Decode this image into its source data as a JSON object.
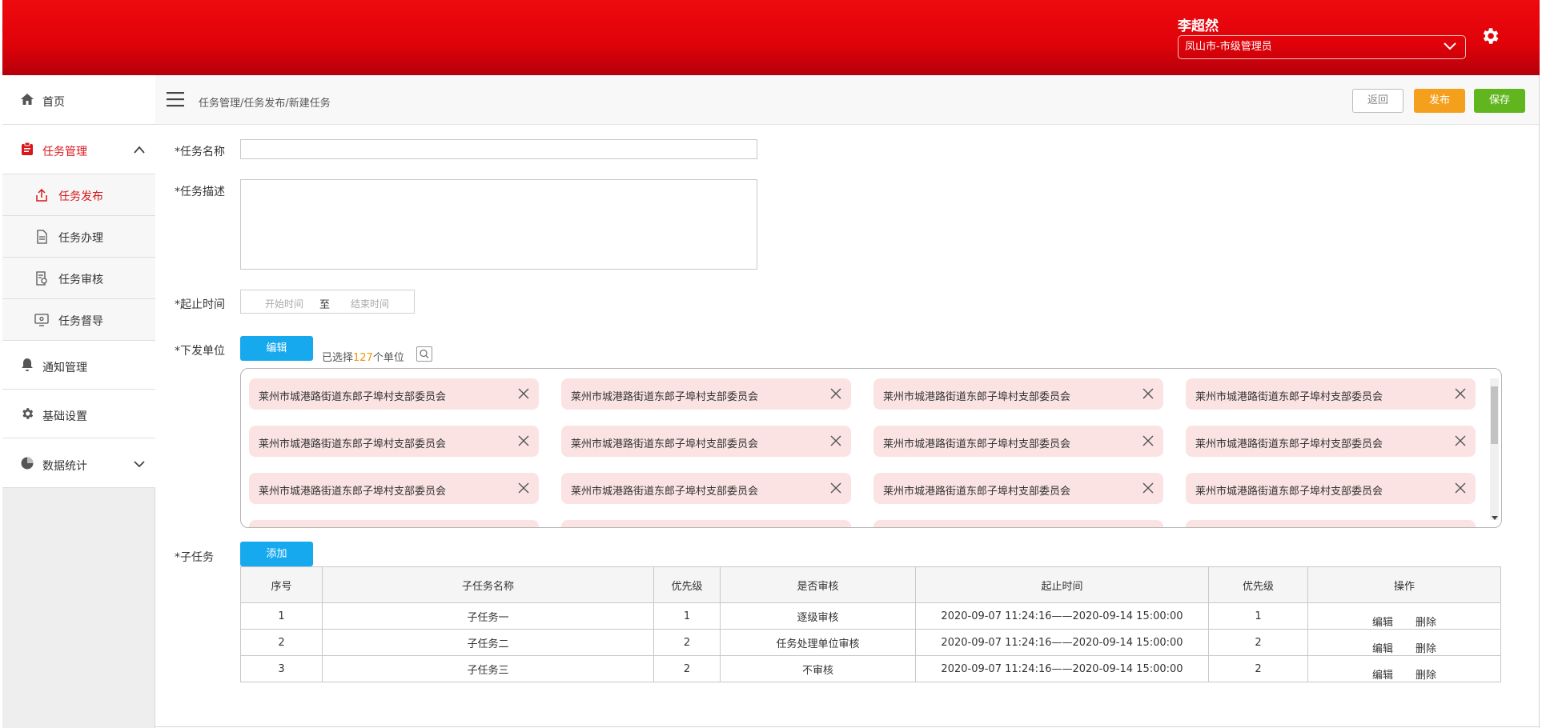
{
  "header": {
    "user_name": "李超然",
    "role": "凤山市-市级管理员"
  },
  "sidebar": {
    "items": [
      {
        "label": "首页"
      },
      {
        "label": "任务管理"
      },
      {
        "label": "通知管理"
      },
      {
        "label": "基础设置"
      },
      {
        "label": "数据统计"
      }
    ],
    "subitems": [
      {
        "label": "任务发布"
      },
      {
        "label": "任务办理"
      },
      {
        "label": "任务审核"
      },
      {
        "label": "任务督导"
      }
    ]
  },
  "topbar": {
    "breadcrumb": "任务管理/任务发布/新建任务",
    "back_label": "返回",
    "publish_label": "发布",
    "save_label": "保存"
  },
  "form": {
    "name_label": "*任务名称",
    "desc_label": "*任务描述",
    "time_label": "*起止时间",
    "start_placeholder": "开始时间",
    "to_label": "至",
    "end_placeholder": "结束时间",
    "units_label": "*下发单位",
    "edit_label": "编辑",
    "selected_prefix": "已选择",
    "selected_count": "127",
    "selected_suffix": "个单位",
    "subtask_label": "*子任务",
    "add_label": "添加"
  },
  "units": [
    "莱州市城港路街道东郎子埠村支部委员会",
    "莱州市城港路街道东郎子埠村支部委员会",
    "莱州市城港路街道东郎子埠村支部委员会",
    "莱州市城港路街道东郎子埠村支部委员会",
    "莱州市城港路街道东郎子埠村支部委员会",
    "莱州市城港路街道东郎子埠村支部委员会",
    "莱州市城港路街道东郎子埠村支部委员会",
    "莱州市城港路街道东郎子埠村支部委员会",
    "莱州市城港路街道东郎子埠村支部委员会",
    "莱州市城港路街道东郎子埠村支部委员会",
    "莱州市城港路街道东郎子埠村支部委员会",
    "莱州市城港路街道东郎子埠村支部委员会"
  ],
  "subtasks": {
    "columns": [
      "序号",
      "子任务名称",
      "优先级",
      "是否审核",
      "起止时间",
      "优先级",
      "操作"
    ],
    "edit_label": "编辑",
    "delete_label": "删除",
    "rows": [
      {
        "no": "1",
        "name": "子任务一",
        "priority": "1",
        "review": "逐级审核",
        "time": "2020-09-07 11:24:16——2020-09-14 15:00:00",
        "priority2": "1"
      },
      {
        "no": "2",
        "name": "子任务二",
        "priority": "2",
        "review": "任务处理单位审核",
        "time": "2020-09-07 11:24:16——2020-09-14 15:00:00",
        "priority2": "2"
      },
      {
        "no": "3",
        "name": "子任务三",
        "priority": "2",
        "review": "不审核",
        "time": "2020-09-07 11:24:16——2020-09-14 15:00:00",
        "priority2": "2"
      }
    ]
  }
}
